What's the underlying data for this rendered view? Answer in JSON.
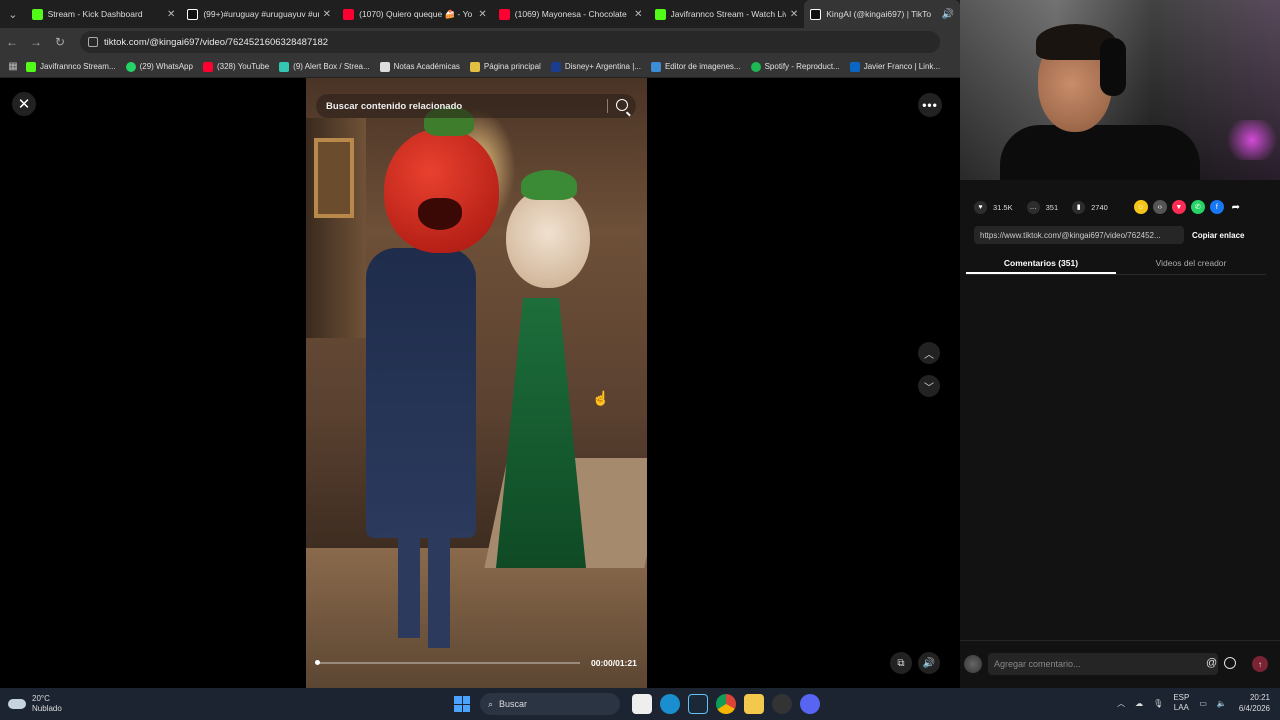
{
  "browser": {
    "tabs": [
      {
        "title": "Stream - Kick Dashboard",
        "color": "#53fc18",
        "active": false
      },
      {
        "title": "(99+)#uruguay #uruguayuv #ur",
        "color": "#ffffff",
        "active": false
      },
      {
        "title": "(1070) Quiero queque 🍰 - Yo",
        "color": "#ff0033",
        "active": false
      },
      {
        "title": "(1069) Mayonesa - Chocolate",
        "color": "#ff0033",
        "active": false
      },
      {
        "title": "Javifrannco Stream - Watch Liv",
        "color": "#53fc18",
        "active": false
      },
      {
        "title": "KingAI (@kingai697) | TikTo",
        "color": "#ffffff",
        "active": true
      }
    ],
    "url": "tiktok.com/@kingai697/video/7624521606328487182",
    "bookmarks": [
      {
        "label": "Javifrannco Stream...",
        "color": "#53fc18"
      },
      {
        "label": "(29) WhatsApp",
        "color": "#25d366"
      },
      {
        "label": "(328) YouTube",
        "color": "#ff0033"
      },
      {
        "label": "(9) Alert Box / Strea...",
        "color": "#33c6b3"
      },
      {
        "label": "Notas Académicas",
        "color": "#dddddd"
      },
      {
        "label": "Página principal",
        "color": "#e2c044"
      },
      {
        "label": "Disney+ Argentina |...",
        "color": "#1c3d8f"
      },
      {
        "label": "Editor de imagenes...",
        "color": "#3b8ed6"
      },
      {
        "label": "Spotify - Reproduct...",
        "color": "#1db954"
      },
      {
        "label": "Javier Franco | Link...",
        "color": "#0a66c2"
      }
    ]
  },
  "player": {
    "search_placeholder": "Buscar contenido relacionado",
    "time": "00:00/01:21",
    "progress": 0.01
  },
  "side": {
    "likes": "31.5K",
    "comments": "351",
    "saves": "2740",
    "link": "https://www.tiktok.com/@kingai697/video/762452...",
    "copy_label": "Copiar enlace",
    "tab_comments": "Comentarios (351)",
    "tab_creator": "Videos del creador",
    "comment_placeholder": "Agregar comentario...",
    "share_colors": [
      "#f5c518",
      "#555555",
      "#fe2c55",
      "#25d366",
      "#1877f2"
    ]
  },
  "taskbar": {
    "temp": "20°C",
    "weather": "Nublado",
    "search": "Buscar",
    "lang1": "ESP",
    "lang2": "LAA",
    "time": "20:21",
    "date": "6/4/2026"
  }
}
